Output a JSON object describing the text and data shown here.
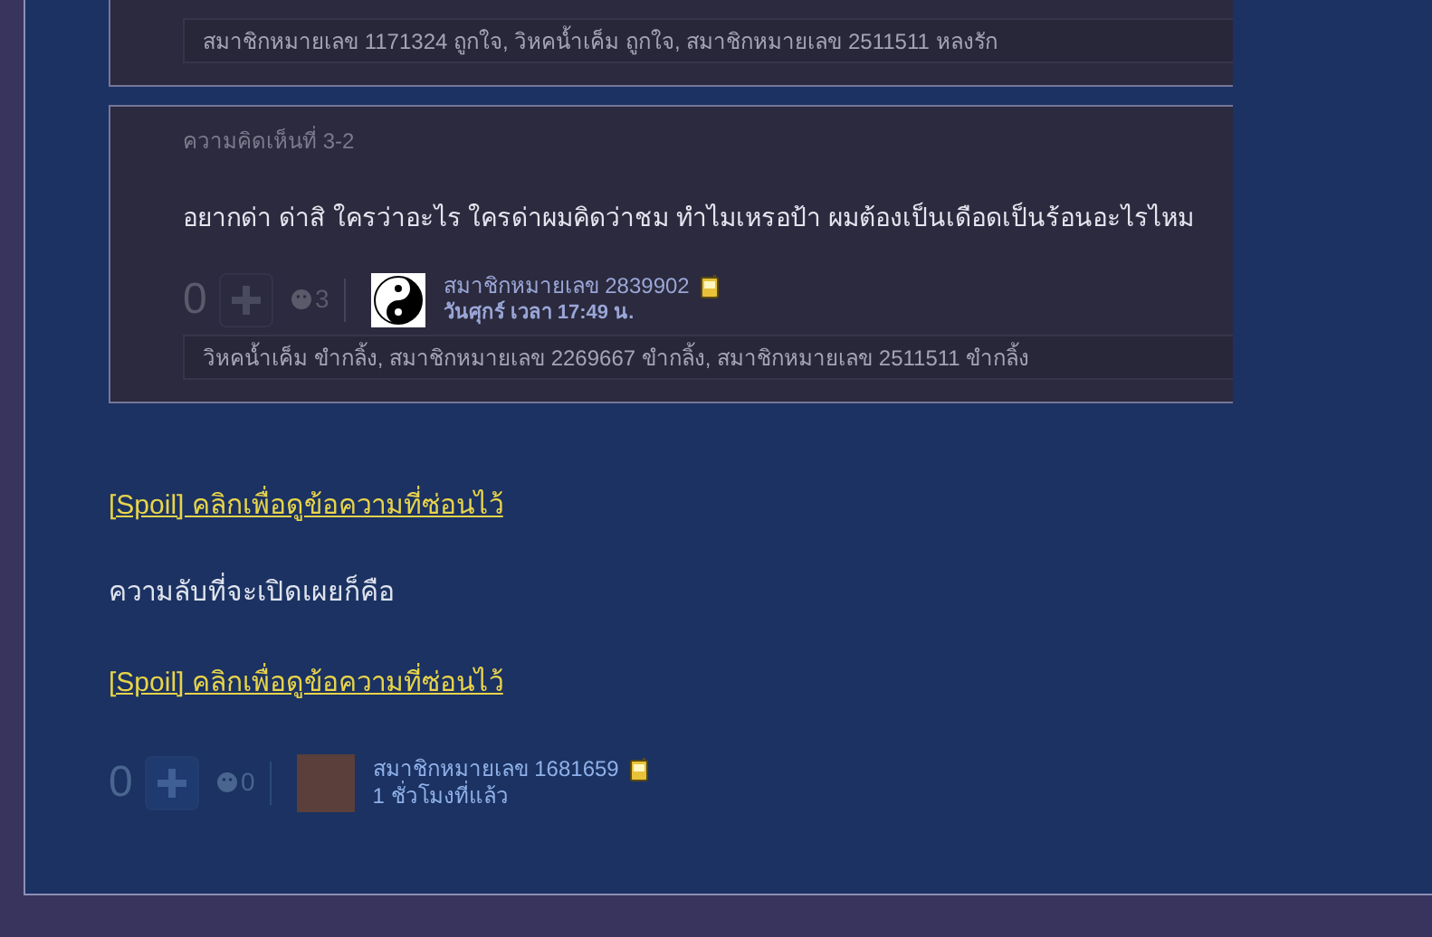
{
  "comments": [
    {
      "reactions": "สมาชิกหมายเลข 1171324 ถูกใจ, วิหคน้ำเค็ม ถูกใจ, สมาชิกหมายเลข 2511511 หลงรัก"
    },
    {
      "label": "ความคิดเห็นที่ 3-2",
      "text": "อยากด่า ด่าสิ ใครว่าอะไร  ใครด่าผมคิดว่าชม ทำไมเหรอป้า  ผมต้องเป็นเดือดเป็นร้อนอะไรไหม",
      "votes": "0",
      "emotions": "3",
      "member": "สมาชิกหมายเลข 2839902",
      "time": "วันศุกร์ เวลา 17:49 น.",
      "reactions": "วิหคน้ำเค็ม ขำกลิ้ง, สมาชิกหมายเลข 2269667 ขำกลิ้ง, สมาชิกหมายเลข 2511511 ขำกลิ้ง"
    }
  ],
  "post": {
    "blocks": [
      {
        "kind": "spoiler",
        "text": "[Spoil] คลิกเพื่อดูข้อความที่ซ่อนไว้"
      },
      {
        "kind": "paragraph",
        "text": "ความลับที่จะเปิดเผยก็คือ"
      },
      {
        "kind": "spoiler",
        "text": "[Spoil] คลิกเพื่อดูข้อความที่ซ่อนไว้"
      }
    ],
    "votes": "0",
    "emotions": "0",
    "member": "สมาชิกหมายเลข 1681659",
    "time": "1 ชั่วโมงที่แล้ว"
  }
}
